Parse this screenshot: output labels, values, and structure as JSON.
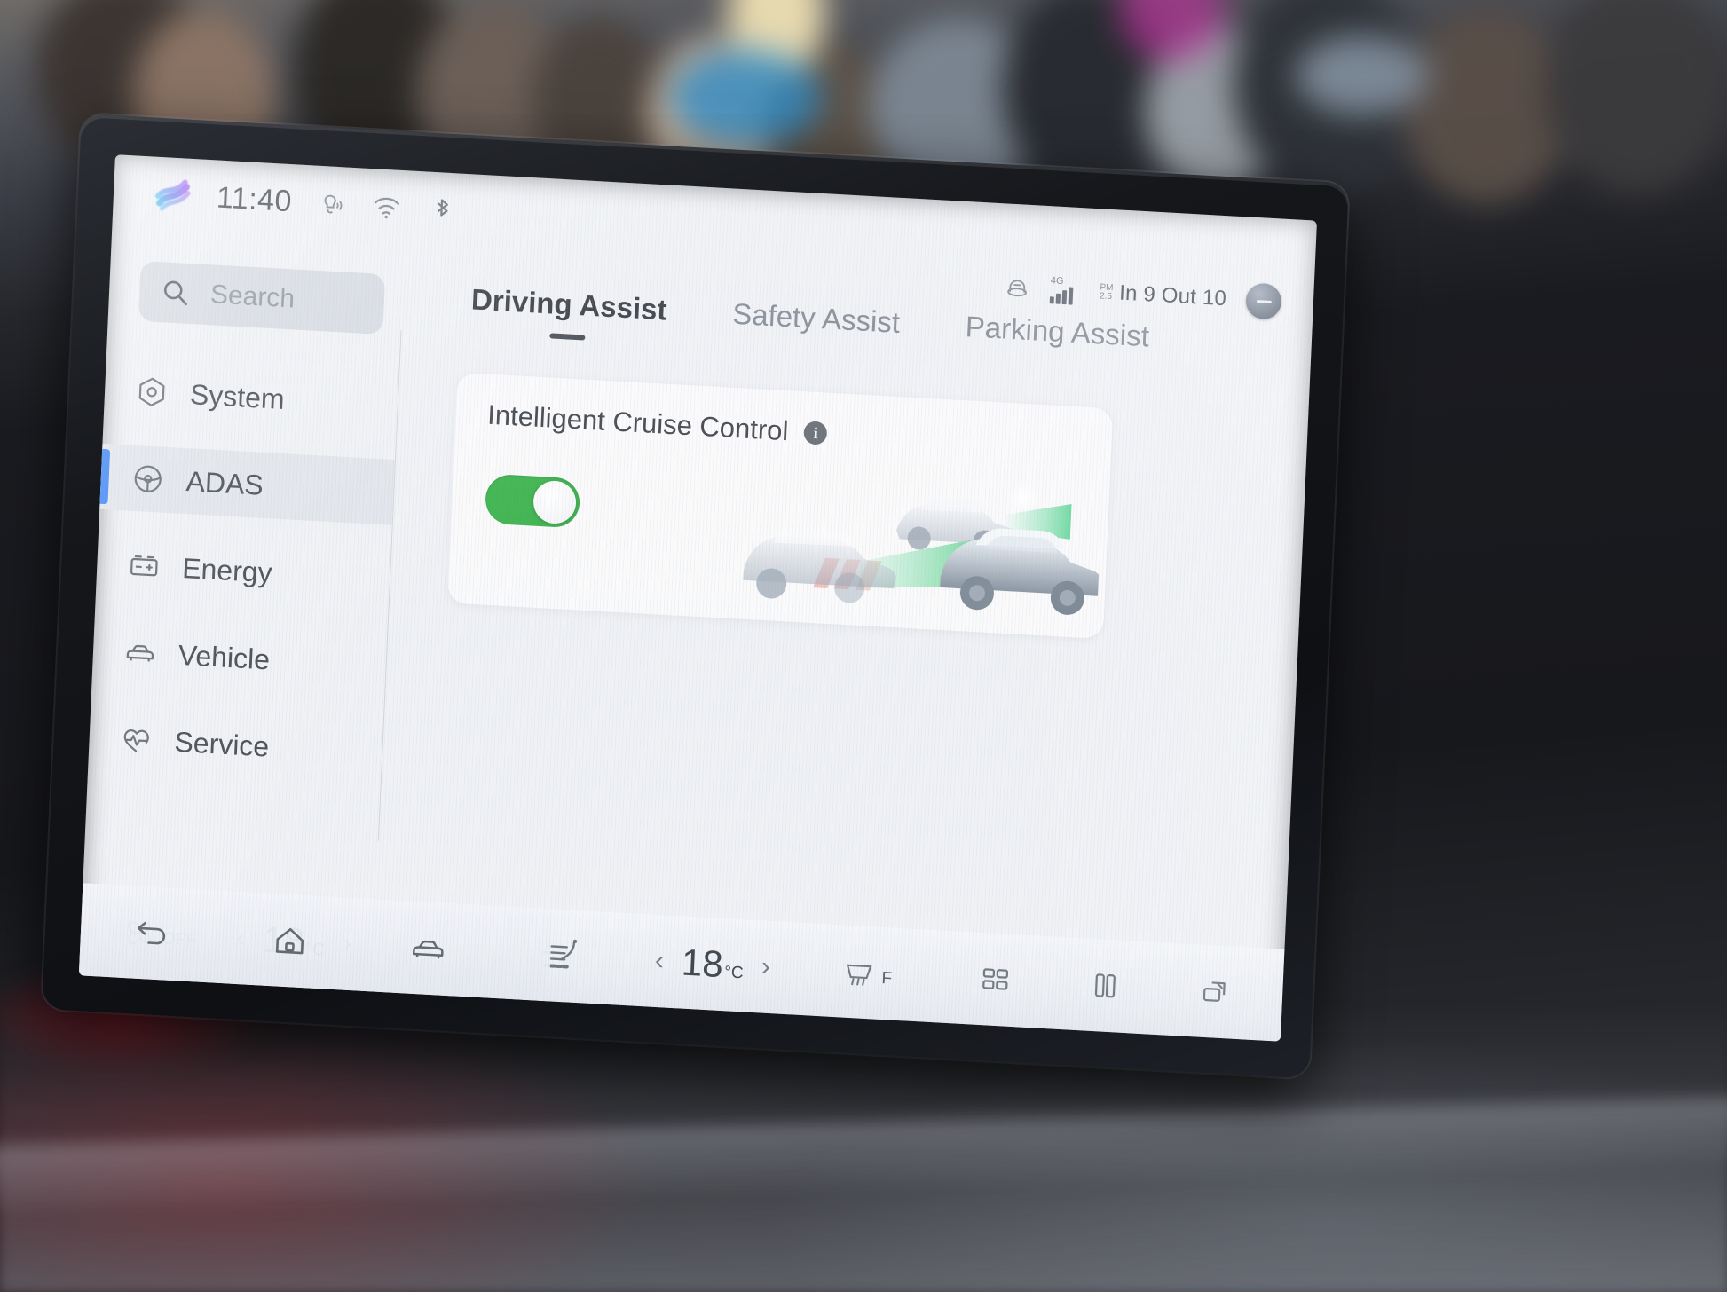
{
  "status_bar": {
    "logo": "brand-wave-logo",
    "clock": "11:40",
    "icons": [
      "voice-assistant-muted-icon",
      "wifi-icon",
      "bluetooth-icon"
    ],
    "right": {
      "air_purifier_icon": "air-purifier-icon",
      "network_label": "4G",
      "signal_icon": "signal-bars-icon",
      "pm_label_top": "PM",
      "pm_label_bottom": "2.5",
      "air_quality": "In 9 Out 10",
      "profile_button": "user-profile-button"
    }
  },
  "sidebar": {
    "search": {
      "placeholder": "Search",
      "value": "",
      "icon": "search-icon"
    },
    "items": [
      {
        "label": "System",
        "icon": "system-hexagon-icon",
        "active": false
      },
      {
        "label": "ADAS",
        "icon": "steering-wheel-icon",
        "active": true
      },
      {
        "label": "Energy",
        "icon": "battery-icon",
        "active": false
      },
      {
        "label": "Vehicle",
        "icon": "car-front-icon",
        "active": false
      },
      {
        "label": "Service",
        "icon": "service-pulse-icon",
        "active": false
      }
    ]
  },
  "content": {
    "tabs": [
      {
        "label": "Driving Assist",
        "active": true
      },
      {
        "label": "Safety Assist",
        "active": false
      },
      {
        "label": "Parking Assist",
        "active": false
      }
    ],
    "card": {
      "title": "Intelligent Cruise Control",
      "info_icon": "info-icon",
      "toggle_state": "on",
      "illustration": "adaptive-cruise-control-illustration"
    }
  },
  "climate_bar": {
    "fan": {
      "icon": "fan-icon",
      "state": "OFF"
    },
    "driver_temp": {
      "value": "18",
      "unit": "°C",
      "left_arrow": "‹",
      "right_arrow": "›"
    },
    "airflow_icon": "seat-airflow-icon",
    "passenger_temp": {
      "value": "18",
      "unit": "°C",
      "left_arrow": "‹",
      "right_arrow": "›"
    },
    "defrost": {
      "icon": "front-defrost-icon",
      "label": "F"
    },
    "right_icons": [
      "apps-grid-icon",
      "split-screen-icon",
      "multi-window-icon"
    ]
  },
  "nav_bar": {
    "items": [
      "back-icon",
      "home-icon",
      "vehicle-icon"
    ]
  },
  "colors": {
    "accent_blue": "#2f7df6",
    "toggle_green": "#2fae3f",
    "screen_bg": "#eef0f4",
    "text_primary": "#34383e",
    "text_muted": "#7d838c"
  }
}
